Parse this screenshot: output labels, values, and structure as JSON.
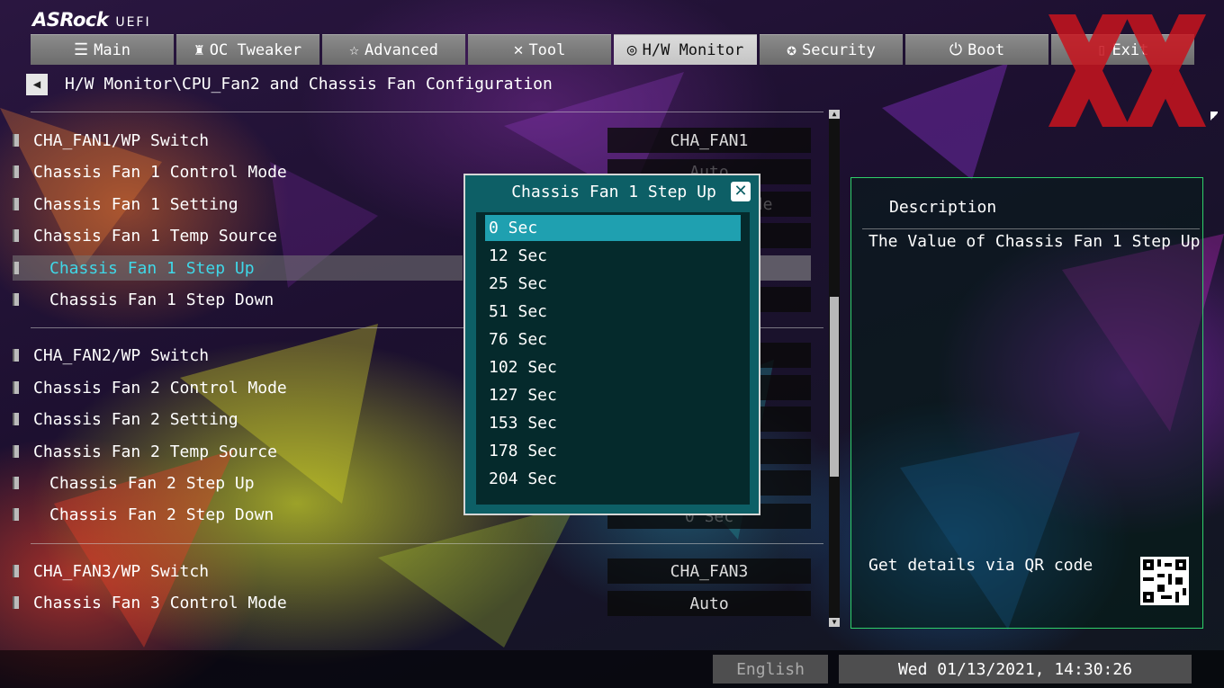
{
  "header": {
    "brand": "ASRock",
    "brand_sub": "UEFI",
    "tabs": [
      {
        "label": "Main",
        "icon": "list-icon"
      },
      {
        "label": "OC Tweaker",
        "icon": "rocket-icon"
      },
      {
        "label": "Advanced",
        "icon": "star-icon"
      },
      {
        "label": "Tool",
        "icon": "wrench-icon"
      },
      {
        "label": "H/W Monitor",
        "icon": "monitor-icon"
      },
      {
        "label": "Security",
        "icon": "shield-icon"
      },
      {
        "label": "Boot",
        "icon": "power-icon"
      },
      {
        "label": "Exit",
        "icon": "exit-icon"
      }
    ],
    "active_tab": "H/W Monitor"
  },
  "breadcrumb": "H/W Monitor\\CPU_Fan2 and Chassis Fan Configuration",
  "settings": [
    {
      "label": "CHA_FAN1/WP Switch",
      "value": "CHA_FAN1"
    },
    {
      "label": "Chassis Fan 1 Control Mode",
      "value": "Auto"
    },
    {
      "label": "Chassis Fan 1 Setting",
      "value": "Standard Mode"
    },
    {
      "label": "Chassis Fan 1 Temp Source",
      "value": ""
    },
    {
      "label": "Chassis Fan 1 Step Up",
      "value": ""
    },
    {
      "label": "Chassis Fan 1 Step Down",
      "value": ""
    },
    {
      "label": "CHA_FAN2/WP Switch",
      "value": ""
    },
    {
      "label": "Chassis Fan 2 Control Mode",
      "value": ""
    },
    {
      "label": "Chassis Fan 2 Setting",
      "value": ""
    },
    {
      "label": "Chassis Fan 2 Temp Source",
      "value": ""
    },
    {
      "label": "Chassis Fan 2 Step Up",
      "value": ""
    },
    {
      "label": "Chassis Fan 2 Step Down",
      "value": "0 Sec"
    },
    {
      "label": "CHA_FAN3/WP Switch",
      "value": "CHA_FAN3"
    },
    {
      "label": "Chassis Fan 3 Control Mode",
      "value": "Auto"
    }
  ],
  "selected_setting": "Chassis Fan 1 Step Up",
  "popup": {
    "title": "Chassis Fan 1 Step Up",
    "close_label": "✕",
    "options": [
      "0 Sec",
      "12 Sec",
      "25 Sec",
      "51 Sec",
      "76 Sec",
      "102 Sec",
      "127 Sec",
      "153 Sec",
      "178 Sec",
      "204 Sec"
    ],
    "selected": "0 Sec"
  },
  "description": {
    "title": "Description",
    "text": "The Value of Chassis Fan 1 Step Up",
    "qr_text": "Get details via QR code"
  },
  "status": {
    "language": "English",
    "datetime": "Wed 01/13/2021, 14:30:26"
  },
  "colors": {
    "accent": "#3fd8e8",
    "popup_bg": "#0d5f66",
    "option_selected": "#1fa0b0",
    "desc_border": "#2fd06a",
    "watermark": "#c8141e"
  }
}
